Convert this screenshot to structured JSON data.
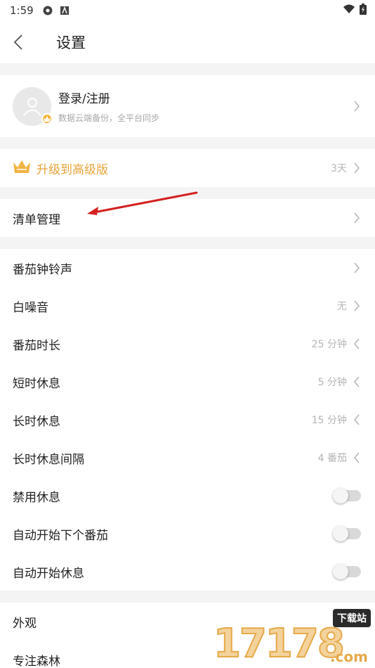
{
  "status_bar": {
    "time": "1:59"
  },
  "header": {
    "title": "设置"
  },
  "profile": {
    "title": "登录/注册",
    "subtitle": "数据云端备份，全平台同步"
  },
  "upgrade": {
    "label": "升级到高级版",
    "value": "3天"
  },
  "list_mgmt": {
    "label": "清单管理"
  },
  "settings": [
    {
      "label": "番茄钟铃声",
      "value": "",
      "type": "chevron-right"
    },
    {
      "label": "白噪音",
      "value": "无",
      "type": "chevron-right"
    },
    {
      "label": "番茄时长",
      "value": "25 分钟",
      "type": "chevron-left"
    },
    {
      "label": "短时休息",
      "value": "5 分钟",
      "type": "chevron-left"
    },
    {
      "label": "长时休息",
      "value": "15 分钟",
      "type": "chevron-left"
    },
    {
      "label": "长时休息间隔",
      "value": "4 番茄",
      "type": "chevron-left"
    },
    {
      "label": "禁用休息",
      "value": "",
      "type": "toggle",
      "on": false
    },
    {
      "label": "自动开始下个番茄",
      "value": "",
      "type": "toggle",
      "on": false
    },
    {
      "label": "自动开始休息",
      "value": "",
      "type": "toggle",
      "on": false
    }
  ],
  "more": [
    {
      "label": "外观"
    },
    {
      "label": "专注森林"
    }
  ],
  "watermark": {
    "digits": "17178",
    "badge": "下载站",
    "suffix": ".com"
  },
  "colors": {
    "accent": "#e8a33a",
    "annotation": "#d42020"
  }
}
